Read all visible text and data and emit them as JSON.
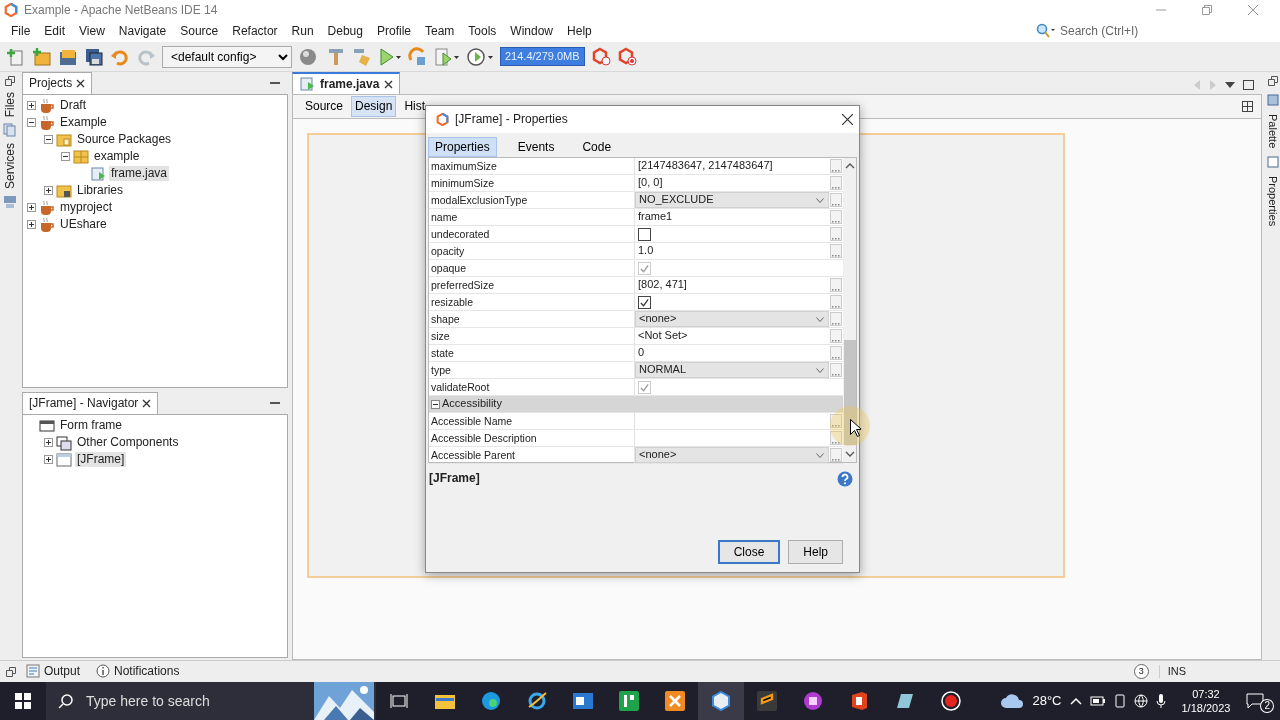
{
  "window": {
    "title": "Example - Apache NetBeans IDE 14"
  },
  "menu": [
    "File",
    "Edit",
    "View",
    "Navigate",
    "Source",
    "Refactor",
    "Run",
    "Debug",
    "Profile",
    "Team",
    "Tools",
    "Window",
    "Help"
  ],
  "search": {
    "placeholder": "Search (Ctrl+I)"
  },
  "toolbar": {
    "config": "<default config>",
    "memory": "214.4/279.0MB"
  },
  "left_strip": [
    "Files",
    "Services"
  ],
  "projects": {
    "title": "Projects",
    "tree": [
      {
        "label": "Draft",
        "kind": "project",
        "expanded": false,
        "selected": false
      },
      {
        "label": "Example",
        "kind": "project",
        "expanded": true,
        "selected": false,
        "children": [
          {
            "label": "Source Packages",
            "kind": "folder",
            "expanded": true,
            "selected": false,
            "children": [
              {
                "label": "example",
                "kind": "package",
                "expanded": true,
                "selected": false,
                "children": [
                  {
                    "label": "frame.java",
                    "kind": "file",
                    "selected": true
                  }
                ]
              }
            ]
          },
          {
            "label": "Libraries",
            "kind": "libraries",
            "expanded": false,
            "selected": false
          }
        ]
      },
      {
        "label": "myproject",
        "kind": "project",
        "expanded": false,
        "selected": false
      },
      {
        "label": "UEshare",
        "kind": "project",
        "expanded": false,
        "selected": false
      }
    ]
  },
  "navigator": {
    "title": "[JFrame] - Navigator",
    "tree": [
      {
        "label": "Form frame",
        "kind": "form",
        "selected": false,
        "children": [
          {
            "label": "Other Components",
            "kind": "components",
            "expanded": false,
            "selected": false
          },
          {
            "label": "[JFrame]",
            "kind": "jframe",
            "expanded": false,
            "selected": true
          }
        ]
      }
    ]
  },
  "editor": {
    "tabs": [
      {
        "label": "frame.java",
        "selected": true
      }
    ],
    "views": [
      {
        "label": "Source",
        "selected": false
      },
      {
        "label": "Design",
        "selected": true
      },
      {
        "label": "Hist",
        "selected": false
      }
    ]
  },
  "right_strip": [
    "Palette",
    "Properties"
  ],
  "dialog": {
    "title": "[JFrame] - Properties",
    "tabs": [
      {
        "label": "Properties",
        "selected": true
      },
      {
        "label": "Events",
        "selected": false
      },
      {
        "label": "Code",
        "selected": false
      }
    ],
    "rows": [
      {
        "name": "maximumSize",
        "kind": "text",
        "value": "[2147483647, 2147483647]",
        "more": true
      },
      {
        "name": "minimumSize",
        "kind": "text",
        "value": "[0, 0]",
        "more": true
      },
      {
        "name": "modalExclusionType",
        "kind": "combo",
        "value": "NO_EXCLUDE",
        "more": true
      },
      {
        "name": "name",
        "kind": "text",
        "value": "frame1",
        "more": true
      },
      {
        "name": "undecorated",
        "kind": "checkbox",
        "checked": false,
        "disabled": false,
        "more": true
      },
      {
        "name": "opacity",
        "kind": "text",
        "value": "1.0",
        "more": true
      },
      {
        "name": "opaque",
        "kind": "checkbox",
        "checked": true,
        "disabled": true,
        "more": false
      },
      {
        "name": "preferredSize",
        "kind": "text",
        "value": "[802, 471]",
        "more": true
      },
      {
        "name": "resizable",
        "kind": "checkbox",
        "checked": true,
        "disabled": false,
        "more": true
      },
      {
        "name": "shape",
        "kind": "combo",
        "value": "<none>",
        "more": true
      },
      {
        "name": "size",
        "kind": "text",
        "value": "<Not Set>",
        "more": true
      },
      {
        "name": "state",
        "kind": "text",
        "value": "0",
        "more": true
      },
      {
        "name": "type",
        "kind": "combo",
        "value": "NORMAL",
        "more": true
      },
      {
        "name": "validateRoot",
        "kind": "checkbox",
        "checked": true,
        "disabled": true,
        "more": false
      },
      {
        "name": "Accessibility",
        "kind": "section",
        "expanded": true
      },
      {
        "name": "Accessible Name",
        "kind": "text",
        "more": true
      },
      {
        "name": "Accessible Description",
        "kind": "text",
        "more": true
      },
      {
        "name": "Accessible Parent",
        "kind": "combo",
        "value": "<none>",
        "more": true
      }
    ],
    "description_title": "[JFrame]",
    "buttons": [
      {
        "label": "Close",
        "default": true
      },
      {
        "label": "Help",
        "default": false
      }
    ]
  },
  "status_bar": {
    "items": [
      {
        "label": "Output",
        "kind": "output"
      },
      {
        "label": "Notifications",
        "kind": "info"
      }
    ],
    "badge": "3",
    "mode": "INS"
  },
  "taskbar": {
    "search": {
      "placeholder": "Type here to search"
    },
    "temperature": "28°C",
    "time": "07:32",
    "date": "1/18/2023",
    "notifications": "2"
  }
}
